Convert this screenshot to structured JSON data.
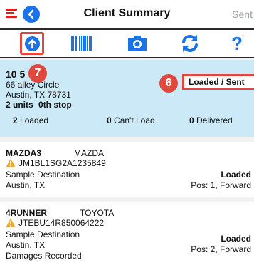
{
  "header": {
    "title": "Client Summary",
    "right_label": "Sent"
  },
  "toolbar": {
    "icons": [
      "upload-icon",
      "barcode-icon",
      "camera-icon",
      "refresh-icon",
      "help-icon"
    ],
    "help_label": "?"
  },
  "callouts": {
    "upload": "7",
    "status": "6"
  },
  "summary": {
    "id": "10 5",
    "address_line1": "66 alley Circle",
    "address_line2": "Austin, TX 78731",
    "units": "2 units",
    "stop": "0th stop",
    "status_label": "Loaded / Sent",
    "loaded_count": "2",
    "loaded_label": "Loaded",
    "cantload_count": "0",
    "cantload_label": "Can't Load",
    "delivered_count": "0",
    "delivered_label": "Delivered"
  },
  "vehicles": [
    {
      "model": "MAZDA3",
      "make": "MAZDA",
      "vin": "JM1BL1SG2A1235849",
      "destination": "Sample Destination",
      "city": "Austin, TX",
      "status": "Loaded",
      "position": "Pos: 1, Forward",
      "note": ""
    },
    {
      "model": "4RUNNER",
      "make": "TOYOTA",
      "vin": "JTEBU14R850064222",
      "destination": "Sample Destination",
      "city": "Austin, TX",
      "status": "Loaded",
      "position": "Pos: 2, Forward",
      "note": "Damages Recorded"
    }
  ],
  "colors": {
    "accent_blue": "#1a73e8",
    "callout_red": "#e0483d",
    "summary_bg": "#cce9f7",
    "warning": "#f5a623"
  }
}
